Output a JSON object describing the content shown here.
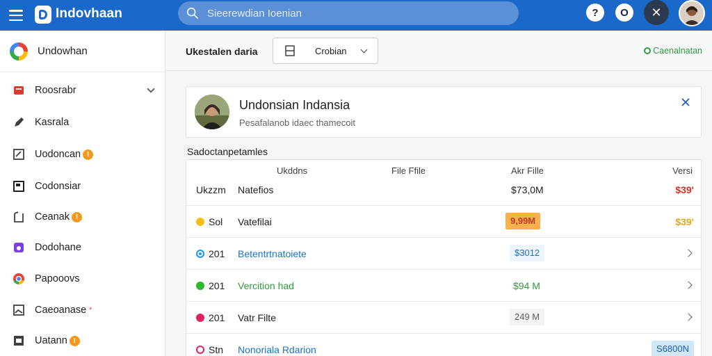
{
  "header": {
    "app_title": "Indovhaan",
    "search_placeholder": "Sieerewdian Ioenian",
    "help_glyph": "?",
    "notif_glyph": "O",
    "close_glyph": "✕"
  },
  "sidebar": {
    "header_label": "Undowhan",
    "items": [
      {
        "label": "Roosrabr"
      },
      {
        "label": "Kasrala"
      },
      {
        "label": "Uodoncan",
        "badge": "!"
      },
      {
        "label": "Codonsiar"
      },
      {
        "label": "Ceanak",
        "badge": "!"
      },
      {
        "label": "Dodohane"
      },
      {
        "label": "Papooovs"
      },
      {
        "label": "Caeoanase",
        "mark": "*"
      },
      {
        "label": "Uatann",
        "badge": "!"
      }
    ]
  },
  "toolbar": {
    "title": "Ukestalen daria",
    "dropdown_label": "Crobian",
    "status": "Caenalnatan"
  },
  "profile": {
    "name": "Undonsian Indansia",
    "subtitle": "Pesafalanob idaec thamecoit"
  },
  "section": {
    "label": "Sadoctanpetamles"
  },
  "table": {
    "headers": [
      "Ukddns",
      "File Ffile",
      "Akr Fille",
      "Versi"
    ],
    "rows": [
      {
        "id": "Ukzzm",
        "name": "Natefios",
        "size": "$73,0M",
        "version": "$39'"
      },
      {
        "id": "Sol",
        "name": "Vatefilai",
        "size": "9,99M",
        "version": "$39'",
        "status_color": "#f4bf1a"
      },
      {
        "id": "201",
        "name": "Betentrtnatoiete",
        "size": "$3012",
        "status_color": "#2196f3"
      },
      {
        "id": "201",
        "name": "Vercition had",
        "size": "$94 M",
        "status_color": "#2eb82e"
      },
      {
        "id": "201",
        "name": "Vatr Filte",
        "size": "249 M",
        "status_color": "#e0245e"
      },
      {
        "id": "Stn",
        "name": "Nonoriala Rdarion",
        "size": "S6800N",
        "status_color": "#e0245e"
      }
    ]
  },
  "colors": {
    "topbar": "#1a68c9",
    "accent_green": "#2e9a3e",
    "link_blue": "#1a73c9",
    "warn_orange": "#f29a1f"
  },
  "icons": {
    "menu": "hamburger-icon",
    "search": "search-icon",
    "help": "help-icon",
    "notification": "notification-icon",
    "close": "close-icon"
  }
}
